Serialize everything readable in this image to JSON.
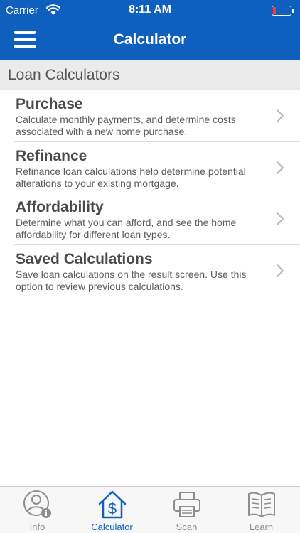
{
  "status_bar": {
    "carrier": "Carrier",
    "time": "8:11 AM"
  },
  "header": {
    "title": "Calculator"
  },
  "section": {
    "title": "Loan Calculators"
  },
  "items": [
    {
      "title": "Purchase",
      "description": "Calculate monthly payments, and determine costs associated with a new home purchase."
    },
    {
      "title": "Refinance",
      "description": "Refinance loan calculations help determine potential alterations to your existing mortgage."
    },
    {
      "title": "Affordability",
      "description": "Determine what you can afford, and see the home affordability for different loan types."
    },
    {
      "title": "Saved Calculations",
      "description": "Save loan calculations on the result screen. Use this option to review previous calculations."
    }
  ],
  "tabs": [
    {
      "label": "Info",
      "icon": "user-info-icon",
      "active": false
    },
    {
      "label": "Calculator",
      "icon": "house-dollar-icon",
      "active": true
    },
    {
      "label": "Scan",
      "icon": "printer-icon",
      "active": false
    },
    {
      "label": "Learn",
      "icon": "open-book-icon",
      "active": false
    }
  ],
  "colors": {
    "brand": "#0f5fbe",
    "section_bg": "#ebebeb",
    "tab_inactive": "#8e8e8e",
    "battery_low": "#ff3b30"
  }
}
